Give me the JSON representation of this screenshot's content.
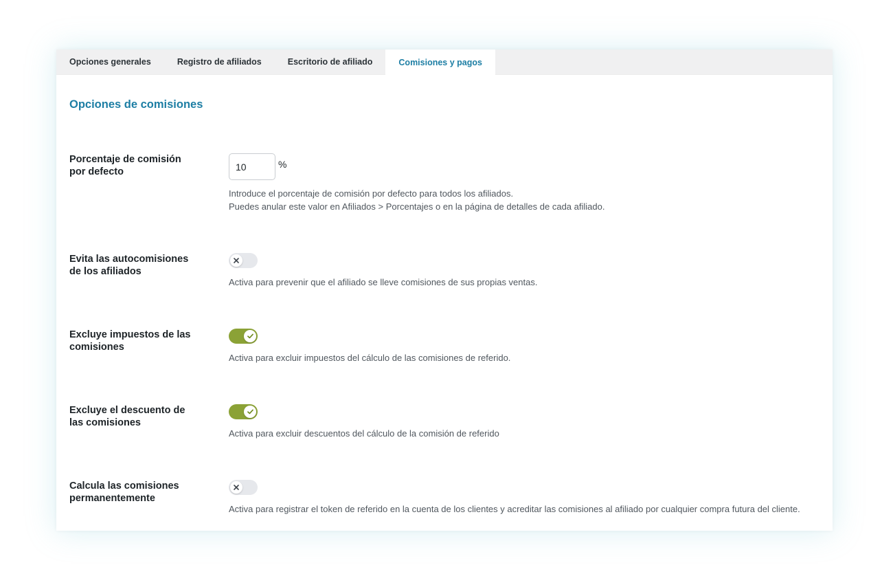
{
  "tabs": [
    {
      "label": "Opciones generales",
      "active": false
    },
    {
      "label": "Registro de afiliados",
      "active": false
    },
    {
      "label": "Escritorio de afiliado",
      "active": false
    },
    {
      "label": "Comisiones y pagos",
      "active": true
    }
  ],
  "section": {
    "title": "Opciones de comisiones"
  },
  "settings": {
    "default_rate": {
      "label": "Porcentaje de comisión por defecto",
      "value": "10",
      "unit": "%",
      "desc_line1": "Introduce el porcentaje de comisión por defecto para todos los afiliados.",
      "desc_line2": "Puedes anular este valor en Afiliados > Porcentajes o en la página de detalles de cada afiliado."
    },
    "self_commission": {
      "label": "Evita las autocomisiones de los afiliados",
      "enabled": false,
      "icon": "close-icon",
      "desc": "Activa para prevenir que el afiliado se lleve comisiones de sus propias ventas."
    },
    "exclude_taxes": {
      "label": "Excluye impuestos de las comisiones",
      "enabled": true,
      "icon": "check-icon",
      "desc": "Activa para excluir impuestos del cálculo de las comisiones de referido."
    },
    "exclude_discounts": {
      "label": "Excluye el descuento de las comisiones",
      "enabled": true,
      "icon": "check-icon",
      "desc": "Activa para excluir descuentos del cálculo de la comisión de referido"
    },
    "permanent": {
      "label": "Calcula las comisiones permanentemente",
      "enabled": false,
      "icon": "close-icon",
      "desc": "Activa para registrar el token de referido en la cuenta de los clientes y acreditar las comisiones al afiliado por cualquier compra futura del cliente."
    }
  },
  "colors": {
    "accent": "#1d7ea4",
    "toggle_on": "#8ba236",
    "toggle_off": "#e6e8ec"
  }
}
